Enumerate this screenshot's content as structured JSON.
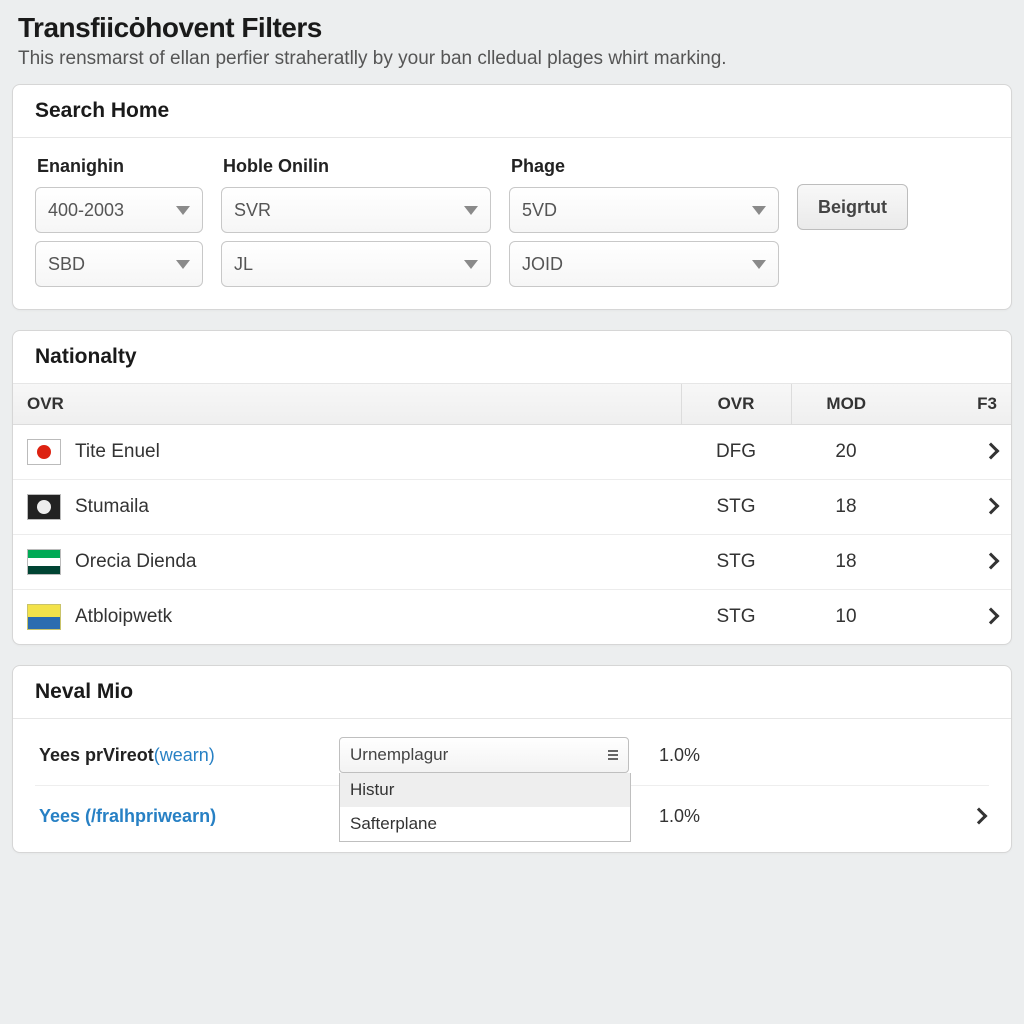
{
  "page": {
    "title": "Transfiicȯhovent Filters",
    "subtitle": "This rensmarst of ellan perfier straheratlly by your ban clledual plages whirt marking."
  },
  "search_panel": {
    "title": "Search Home",
    "labels": {
      "col1": "Enanighin",
      "col2": "Hoble Onilin",
      "col3": "Phage"
    },
    "row1": {
      "c1": "400-2003",
      "c2": "SVR",
      "c3": "5VD"
    },
    "row2": {
      "c1": "SBD",
      "c2": "JL",
      "c3": "JOID"
    },
    "button": "Beigrtut"
  },
  "nat_panel": {
    "title": "Nationalty",
    "columns": {
      "ovr": "OVR",
      "ovr2": "OVR",
      "mod": "MOD",
      "f3": "F3"
    },
    "rows": [
      {
        "flag": "jp",
        "name": "Tite Enuel",
        "ovr2": "DFG",
        "mod": "20"
      },
      {
        "flag": "dk",
        "name": "Stumaila",
        "ovr2": "STG",
        "mod": "18"
      },
      {
        "flag": "ng",
        "name": "Orecia Dienda",
        "ovr2": "STG",
        "mod": "18"
      },
      {
        "flag": "ua",
        "name": "Atbloipwetk",
        "ovr2": "STG",
        "mod": "10"
      }
    ]
  },
  "neval_panel": {
    "title": "Neval Mio",
    "rows": [
      {
        "label_main": "Yees prVireot",
        "label_paren": "(wearn)",
        "select_value": "Urnemplagur",
        "select_options": [
          "Histur",
          "Safterplane"
        ],
        "value": "1.0%",
        "link_style": false,
        "has_open_dropdown": true,
        "has_chevron": false
      },
      {
        "label_main": "Yees (/fralhpriwearn)",
        "label_paren": "",
        "select_value": "",
        "select_options": [],
        "value": "1.0%",
        "link_style": true,
        "has_open_dropdown": false,
        "has_chevron": true
      }
    ]
  }
}
